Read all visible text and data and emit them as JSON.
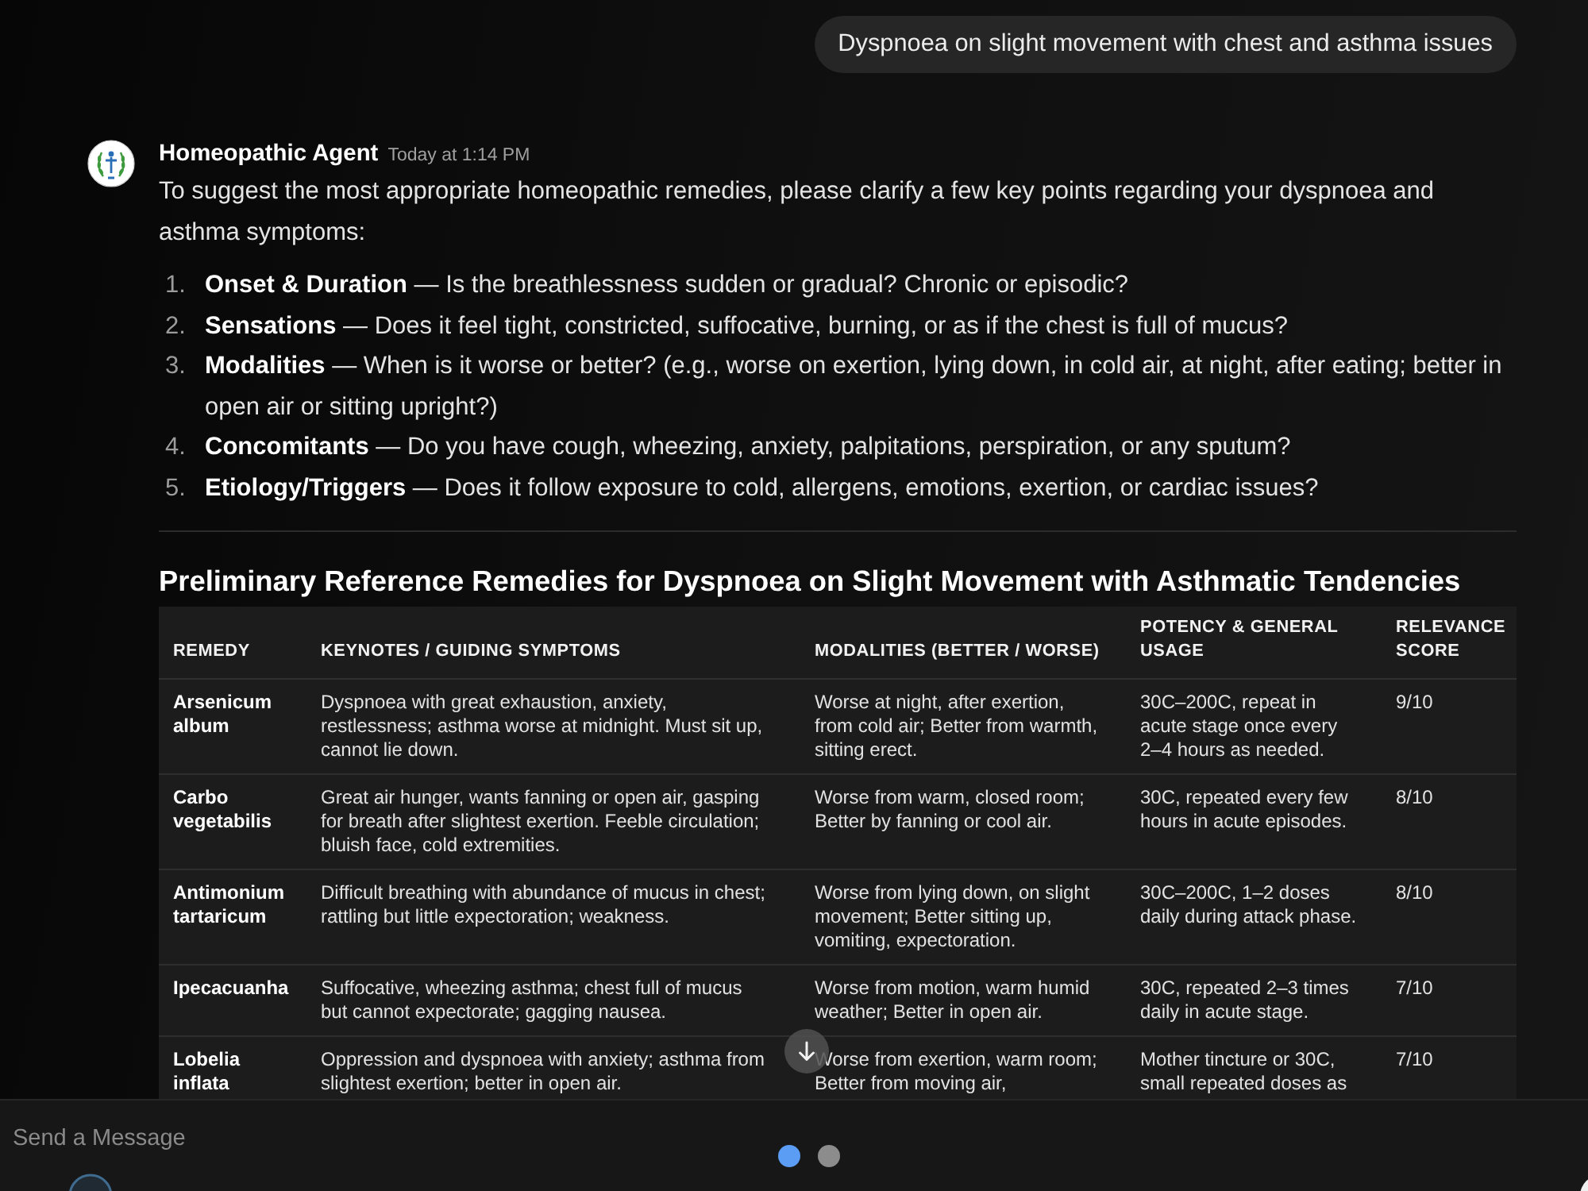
{
  "user_message": {
    "text": "Dyspnoea on slight movement with chest and asthma issues"
  },
  "reply": {
    "sender": "Homeopathic Agent",
    "time": "Today at 1:14 PM",
    "intro": "To suggest the most appropriate homeopathic remedies, please clarify a few key points regarding your dyspnoea and asthma symptoms:",
    "questions": [
      {
        "number": "1.",
        "text": "**Onset & Duration** — Is the breathlessness sudden or gradual? Chronic or episodic?"
      },
      {
        "number": "2.",
        "text": "**Sensations** — Does it feel tight, constricted, suffocative, burning, or as if the chest is full of mucus?"
      },
      {
        "number": "3.",
        "text": "**Modalities** — When is it worse or better? (e.g., worse on exertion, lying down, in cold air, at night, after eating; better in open air or sitting upright?)"
      },
      {
        "number": "4.",
        "text": "**Concomitants** — Do you have cough, wheezing, anxiety, palpitations, perspiration, or any sputum?"
      },
      {
        "number": "5.",
        "text": "**Etiology/Triggers** — Does it follow exposure to cold, allergens, emotions, exertion, or cardiac issues?"
      }
    ],
    "table": {
      "title": "Preliminary Reference Remedies for Dyspnoea on Slight Movement with Asthmatic Tendencies",
      "columns": [
        "REMEDY",
        "KEYNOTES / GUIDING SYMPTOMS",
        "MODALITIES (BETTER / WORSE)",
        "POTENCY & GENERAL USAGE",
        "RELEVANCE SCORE"
      ],
      "rows": [
        [
          "Arsenicum album",
          "Dyspnoea with great exhaustion, anxiety, restlessness; asthma worse at midnight. Must sit up, cannot lie down.",
          "Worse at night, after exertion, from cold air; Better from warmth, sitting erect.",
          "30C–200C, repeat in acute stage once every 2–4 hours as needed.",
          "9/10"
        ],
        [
          "Carbo vegetabilis",
          "Great air hunger, wants fanning or open air, gasping for breath after slightest exertion. Feeble circulation; bluish face, cold extremities.",
          "Worse from warm, closed room; Better by fanning or cool air.",
          "30C, repeated every few hours in acute episodes.",
          "8/10"
        ],
        [
          "Antimonium tartaricum",
          "Difficult breathing with abundance of mucus in chest; rattling but little expectoration; weakness.",
          "Worse from lying down, on slight movement; Better sitting up, vomiting, expectoration.",
          "30C–200C, 1–2 doses daily during attack phase.",
          "8/10"
        ],
        [
          "Ipecacuanha",
          "Suffocative, wheezing asthma; chest full of mucus but cannot expectorate; gagging nausea.",
          "Worse from motion, warm humid weather; Better in open air.",
          "30C, repeated 2–3 times daily in acute stage.",
          "7/10"
        ],
        [
          "Lobelia inflata",
          "Oppression and dyspnoea with anxiety; asthma from slightest exertion; better in open air.",
          "Worse from exertion, warm room; Better from moving air,",
          "Mother tincture or 30C, small repeated doses as",
          "7/10"
        ]
      ]
    }
  },
  "composer": {
    "placeholder": "Send a Message"
  },
  "page_dots": [
    {
      "selected": true
    },
    {
      "selected": false
    }
  ]
}
